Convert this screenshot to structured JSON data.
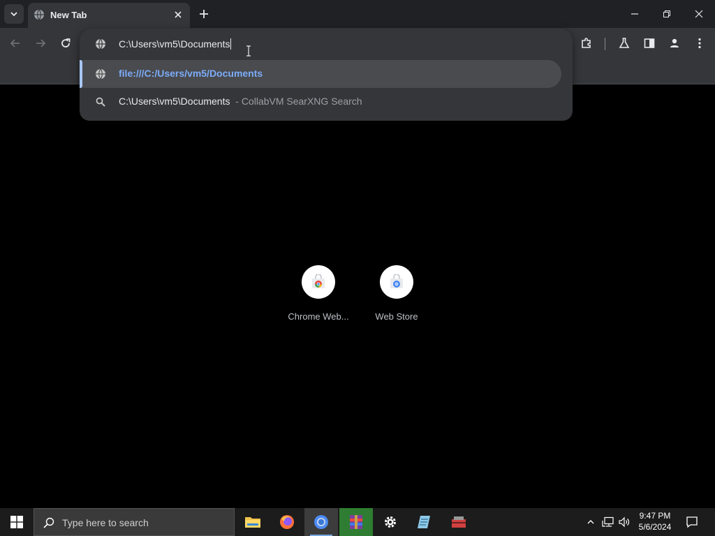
{
  "tab": {
    "title": "New Tab"
  },
  "omnibox": {
    "input_value": "C:\\Users\\vm5\\Documents",
    "suggestions": [
      {
        "label": "file:///C:/Users/vm5/Documents",
        "description": "",
        "icon": "globe-icon",
        "selected": true
      },
      {
        "label": "C:\\Users\\vm5\\Documents",
        "description": "- CollabVM SearXNG Search",
        "icon": "search-icon",
        "selected": false
      }
    ]
  },
  "shortcuts": [
    {
      "name": "Chrome Web..."
    },
    {
      "name": "Web Store"
    }
  ],
  "taskbar": {
    "search_placeholder": "Type here to search",
    "time": "9:47 PM",
    "date": "5/6/2024"
  },
  "colors": {
    "accent": "#a8c7fa",
    "link": "#7cacf8",
    "toolbar": "#35363a",
    "tabstrip": "#202124",
    "taskbar": "#1c1c1c"
  }
}
